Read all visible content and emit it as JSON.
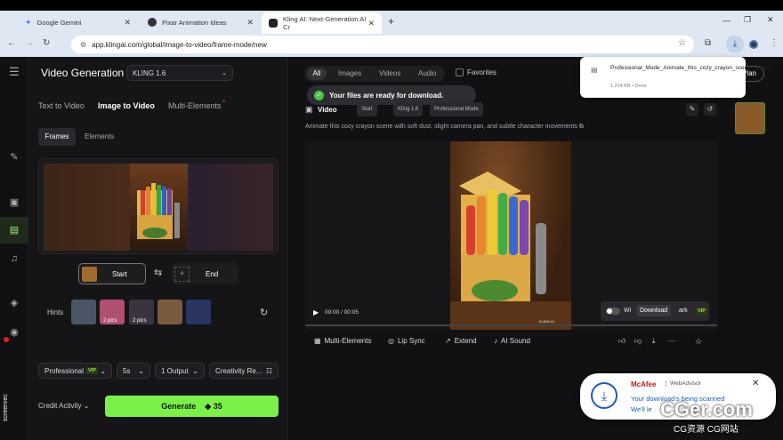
{
  "browser": {
    "tabs": [
      {
        "label": "Google Gemini"
      },
      {
        "label": "Pixar Animation Ideas"
      },
      {
        "label": "Kling AI: Next-Generation AI Cr"
      }
    ],
    "url": "app.klingai.com/global/image-to-video/frame-mode/new",
    "download_popup": {
      "filename": "Professional_Mode_Animate_this_cozy_crayon_scene_w.mp4",
      "meta": "1,214 KB • Done"
    }
  },
  "header": {
    "title": "Video Generation",
    "model": "KLING 1.6"
  },
  "mode_tabs": [
    "Text to Video",
    "Image to Video",
    "Multi-Elements"
  ],
  "sub_tabs": [
    "Frames",
    "Elements"
  ],
  "frames": {
    "start": "Start",
    "end": "End"
  },
  "hints": {
    "label": "Hints",
    "badge_pics": "2 pics"
  },
  "settings": {
    "mode": "Professional",
    "mode_badge": "VIP",
    "duration": "5s",
    "output": "1 Output",
    "creativity": "Creativity Re..."
  },
  "footer": {
    "credit": "Credit Activity",
    "generate": "Generate",
    "cost": "35"
  },
  "filters": {
    "items": [
      "All",
      "Images",
      "Videos",
      "Audio"
    ],
    "favorites": "Favorites",
    "plan": "Plan"
  },
  "toast": "Your files are ready for download.",
  "video_section": {
    "title": "Video",
    "chips": [
      "Start",
      "Kling 1.6",
      "Professional Mode"
    ]
  },
  "prompt": "Animate this cozy crayon scene with soft dust, slight camera pan, and subtle character movements",
  "player": {
    "time": "00:00 / 00:05",
    "watermark_prefix": "Wi",
    "watermark_suffix": "ark",
    "watermark_badge": "VIP",
    "download_tooltip": "Download",
    "image_watermark": "KLING AI"
  },
  "video_tools": [
    "Multi-Elements",
    "Lip Sync",
    "Extend",
    "AI Sound"
  ],
  "mcafee": {
    "brand": "McAfee",
    "product": "WebAdvisor",
    "line1": "Your download's being scanned",
    "line2": "We'll le"
  },
  "watermark": {
    "main": "CGer.com",
    "sub": "CG资源 CG网站",
    "side": "screenrec"
  }
}
